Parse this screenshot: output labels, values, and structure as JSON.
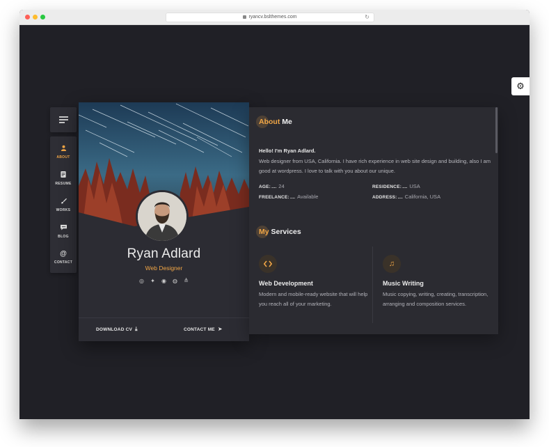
{
  "browser": {
    "url": "ryancv.bslthemes.com",
    "reload_glyph": "↻"
  },
  "settings": {
    "icon": "gear-icon",
    "glyph": "⚙"
  },
  "nav": {
    "menu_icon": "hamburger-icon",
    "items": [
      {
        "label": "ABOUT",
        "icon": "user-icon",
        "glyph": "👤",
        "active": true
      },
      {
        "label": "RESUME",
        "icon": "document-icon",
        "glyph": "▤",
        "active": false
      },
      {
        "label": "WORKS",
        "icon": "brush-icon",
        "glyph": "✎",
        "active": false
      },
      {
        "label": "BLOG",
        "icon": "chat-icon",
        "glyph": "▪",
        "active": false
      },
      {
        "label": "CONTACT",
        "icon": "at-icon",
        "glyph": "@",
        "active": false
      }
    ]
  },
  "profile": {
    "name": "Ryan Adlard",
    "role": "Web Designer",
    "socials": [
      {
        "icon": "dribbble-icon",
        "glyph": "◎"
      },
      {
        "icon": "twitter-icon",
        "glyph": "✦"
      },
      {
        "icon": "github-icon",
        "glyph": "◉"
      },
      {
        "icon": "spotify-icon",
        "glyph": "◍"
      },
      {
        "icon": "stackoverflow-icon",
        "glyph": "≜"
      }
    ],
    "download_label": "DOWNLOAD CV",
    "download_glyph": "⤓",
    "contact_label": "CONTACT ME",
    "contact_glyph": "➤"
  },
  "about": {
    "title_accent": "About",
    "title_rest": " Me",
    "hello": "Hello! I'm Ryan Adlard.",
    "bio": "Web designer from USA, California. I have rich experience in web site design and building, also I am good at wordpress. I love to talk with you about our unique.",
    "info": [
      {
        "key": "AGE:",
        "value": "24"
      },
      {
        "key": "RESIDENCE:",
        "value": "USA"
      },
      {
        "key": "FREELANCE:",
        "value": "Available"
      },
      {
        "key": "ADDRESS:",
        "value": "California, USA"
      }
    ],
    "dots": "...."
  },
  "services": {
    "title_accent": "My",
    "title_rest": " Services",
    "items": [
      {
        "icon": "code-icon",
        "glyph": "‹›",
        "title": "Web Development",
        "desc": "Modern and mobile-ready website that will help you reach all of your marketing."
      },
      {
        "icon": "music-icon",
        "glyph": "♫",
        "title": "Music Writing",
        "desc": "Music copying, writing, creating, transcription, arranging and composition services."
      }
    ]
  },
  "colors": {
    "accent": "#f1a646",
    "background": "#202026",
    "card": "#2c2c33"
  }
}
